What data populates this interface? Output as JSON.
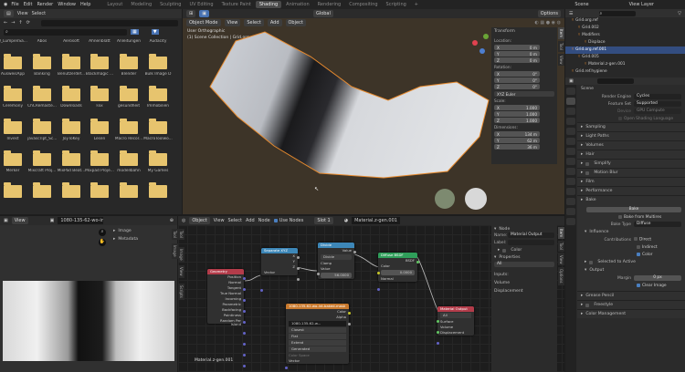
{
  "top_menu": [
    "File",
    "Edit",
    "Render",
    "Window",
    "Help"
  ],
  "workspaces": [
    "Layout",
    "Modeling",
    "Sculpting",
    "UV Editing",
    "Texture Paint",
    "Shading",
    "Animation",
    "Rendering",
    "Compositing",
    "Scripting",
    "+"
  ],
  "active_workspace": "Shading",
  "scene": "Scene",
  "view_layer": "View Layer",
  "file_browser": {
    "menu": [
      "View",
      "Select"
    ],
    "folders": [
      "0_LumpenSa...",
      "Abos",
      "Aerosoft",
      "Ahnenblatt",
      "Anleitungen",
      "Audacity",
      "AusweisApp",
      "Banking",
      "Benutzerdef...",
      "Blackmagic ...",
      "Blender",
      "Bulk Image D",
      "Ceremony",
      "ChCRemaste...",
      "Downloads",
      "Fax",
      "gesundheit",
      "Immobilien",
      "Invest",
      "javascript_Sc...",
      "JoyToKey",
      "Lesen",
      "Macro Recor...",
      "MacroToolwo...",
      "Merker",
      "Mixcraft Proj...",
      "MixPad Beat...",
      "Mixpad Proje...",
      "modellbahn",
      "My Games"
    ]
  },
  "viewport": {
    "mode": "Object Mode",
    "menu": [
      "View",
      "Select",
      "Add",
      "Object"
    ],
    "transform_orientation": "Global",
    "options": "Options",
    "view_name": "User Orthographic",
    "collection": "(1) Scene Collection | Grid.org.ref.001"
  },
  "n_panel": {
    "title": "Transform",
    "location_label": "Location:",
    "location": [
      [
        "X",
        "0 m"
      ],
      [
        "Y",
        "0 m"
      ],
      [
        "Z",
        "0 m"
      ]
    ],
    "rotation_label": "Rotation:",
    "rotation": [
      [
        "X",
        "0°"
      ],
      [
        "Y",
        "0°"
      ],
      [
        "Z",
        "0°"
      ]
    ],
    "rotation_mode": "XYZ Euler",
    "scale_label": "Scale:",
    "scale": [
      [
        "X",
        "1.000"
      ],
      [
        "Y",
        "1.000"
      ],
      [
        "Z",
        "1.000"
      ]
    ],
    "dimensions_label": "Dimensions:",
    "dimensions": [
      [
        "X",
        "134 m"
      ],
      [
        "Y",
        "62 m"
      ],
      [
        "Z",
        "36 m"
      ]
    ],
    "tabs": [
      "Item",
      "Tool",
      "View"
    ]
  },
  "outliner": {
    "items": [
      {
        "label": "Grid.org.ref",
        "indent": 1
      },
      {
        "label": "Grid.002",
        "indent": 2
      },
      {
        "label": "Modifiers",
        "indent": 2
      },
      {
        "label": "Displace",
        "indent": 3
      },
      {
        "label": "Grid.org.ref.001",
        "indent": 1,
        "selected": true
      },
      {
        "label": "Grid.005",
        "indent": 2
      },
      {
        "label": "Material.z-gen.001",
        "indent": 3
      },
      {
        "label": "Grid.ref.hygiene",
        "indent": 1
      }
    ]
  },
  "properties": {
    "title": "Scene",
    "render_engine_label": "Render Engine",
    "render_engine": "Cycles",
    "feature_set_label": "Feature Set",
    "feature_set": "Supported",
    "device_label": "Device",
    "device": "GPU Compute",
    "osl": "Open Shading Language",
    "sections": [
      "Sampling",
      "Light Paths",
      "Volumes",
      "Hair",
      "Simplify",
      "Motion Blur",
      "Film",
      "Performance",
      "Bake"
    ],
    "bake": {
      "button": "Bake",
      "from_multires": "Bake from Multires",
      "bake_type_label": "Bake Type",
      "bake_type": "Diffuse",
      "influence": "Influence",
      "contributions": "Contributions",
      "direct": "Direct",
      "indirect": "Indirect",
      "color": "Color",
      "selected_to_active": "Selected to Active",
      "output": "Output",
      "margin_label": "Margin",
      "margin": "0 px",
      "clear_image": "Clear Image"
    },
    "more_sections": [
      "Grease Pencil",
      "Freestyle",
      "Color Management"
    ]
  },
  "image_editor": {
    "menu": "View",
    "image_name": "1080-135-62-wo-int...",
    "panels": [
      "Image",
      "Metadata"
    ],
    "tabs": [
      "Tool",
      "Image"
    ]
  },
  "node_editor": {
    "object": "Object",
    "menu": [
      "View",
      "Select",
      "Add",
      "Node"
    ],
    "use_nodes": "Use Nodes",
    "slot": "Slot 1",
    "material": "Material.z-gen.001",
    "footer": "Material.z-gen.001",
    "tabs": [
      "Tool",
      "Image",
      "View",
      "Scripts"
    ],
    "nodes": {
      "geometry": {
        "title": "Geometry",
        "outputs": [
          "Position",
          "Normal",
          "Tangent",
          "True Normal",
          "Incoming",
          "Parametric",
          "Backfacing",
          "Pointiness",
          "Random Per Island"
        ]
      },
      "separate": {
        "title": "Separate XYZ",
        "outputs": [
          "X",
          "Y",
          "Z"
        ],
        "input": "Vector"
      },
      "divide": {
        "title": "Divide",
        "output": "Value",
        "op": "Divide",
        "clamp": "Clamp",
        "input": "Value",
        "value_label": "Value",
        "value": "56.0000"
      },
      "diffuse": {
        "title": "Diffuse BSDF",
        "output": "BSDF",
        "color": "Color",
        "roughness_label": "Roughness",
        "roughness": "0.0000",
        "normal": "Normal"
      },
      "image": {
        "title": "1080-135-62-wo-int-baked-mask",
        "outputs": [
          "Color",
          "Alpha"
        ],
        "image": "1080-135-62-w...",
        "interp": "Closest",
        "proj": "Flat",
        "ext": "Extend",
        "cs": "Generated",
        "color_space": "Color Space",
        "alpha": "Linear",
        "vector": "Vector"
      },
      "output": {
        "title": "Material Output",
        "target": "All",
        "inputs": [
          "Surface",
          "Volume",
          "Displacement"
        ]
      }
    },
    "sidebar": {
      "node_title": "Node",
      "name_label": "Name:",
      "name": "Material Output",
      "label_label": "Label:",
      "color": "Color",
      "properties": "Properties",
      "target": "All",
      "inputs_label": "Inputs:",
      "inputs": [
        "Volume",
        "Displacement"
      ],
      "tabs": [
        "Item",
        "Tool",
        "View",
        "Options"
      ]
    }
  },
  "colors": {
    "accent": "#4772b3",
    "selection": "#e78a2e",
    "folder": "#e7c46e"
  }
}
